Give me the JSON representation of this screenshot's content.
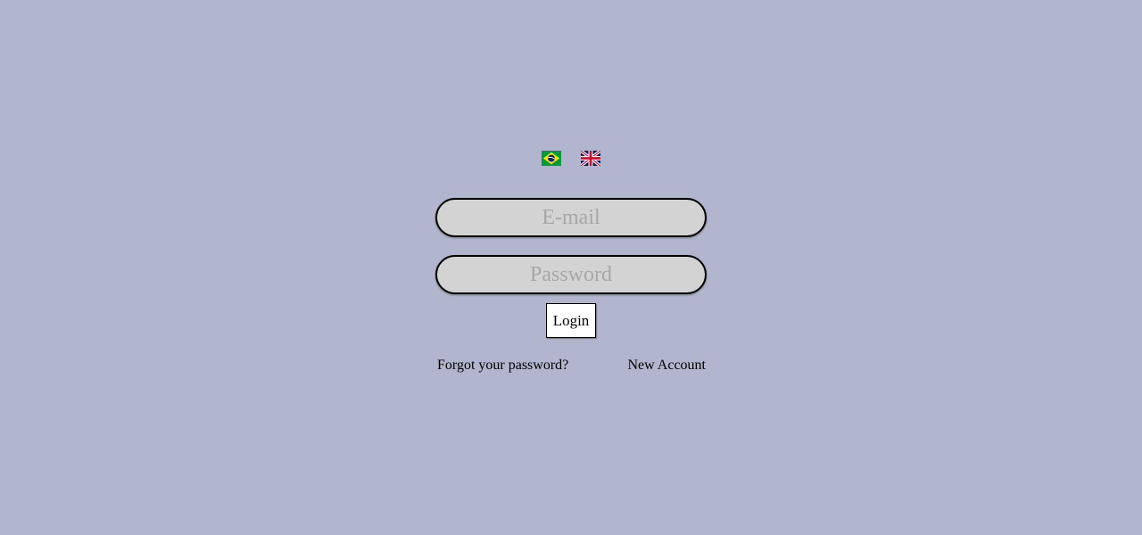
{
  "languages": [
    {
      "name": "brazil-flag-icon",
      "colors": {
        "green": "#009c3b",
        "yellow": "#ffdf00",
        "blue": "#002776"
      }
    },
    {
      "name": "uk-flag-icon",
      "colors": {
        "blue": "#012169",
        "red": "#c8102e",
        "white": "#ffffff"
      }
    }
  ],
  "form": {
    "email_placeholder": "E-mail",
    "password_placeholder": "Password",
    "login_label": "Login"
  },
  "links": {
    "forgot_password": "Forgot your password?",
    "new_account": "New Account"
  },
  "colors": {
    "background": "#b1b6ce",
    "field_background": "#d3d3d3",
    "placeholder": "#a7a7a7"
  }
}
